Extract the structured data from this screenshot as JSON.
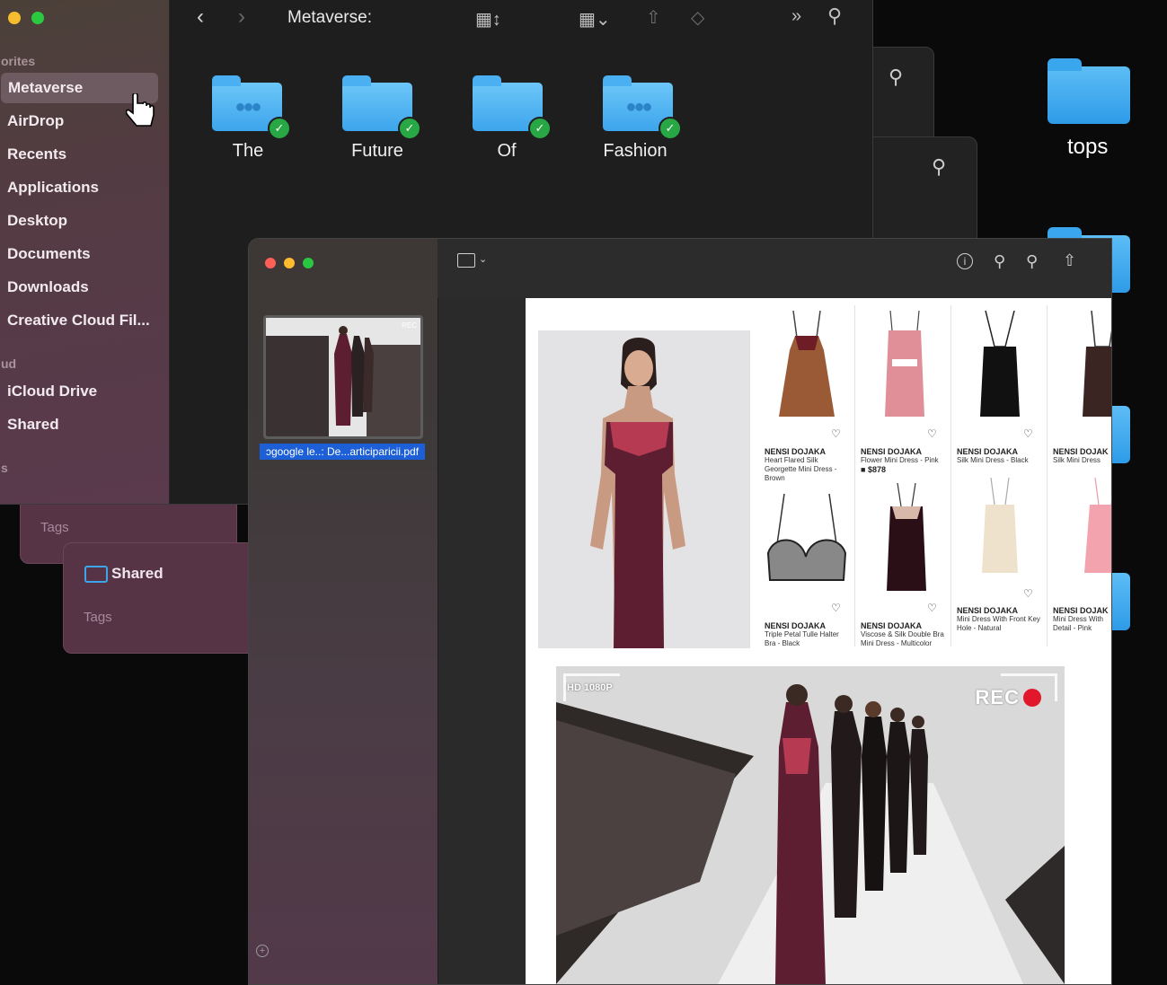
{
  "desktop": {
    "folder_label": "tops"
  },
  "back_windows": {
    "tags_label_1": "Tags",
    "shared_label": "Shared",
    "tags_label_2": "Tags"
  },
  "finder": {
    "title": "Metaverse:",
    "sidebar": {
      "favorites_header": "orites",
      "icloud_header": "ud",
      "locations_header": "s",
      "items": [
        {
          "label": "Metaverse"
        },
        {
          "label": "AirDrop"
        },
        {
          "label": "Recents"
        },
        {
          "label": "Applications"
        },
        {
          "label": "Desktop"
        },
        {
          "label": "Documents"
        },
        {
          "label": "Downloads"
        },
        {
          "label": "Creative Cloud Fil..."
        }
      ],
      "icloud_items": [
        {
          "label": "iCloud Drive"
        },
        {
          "label": "Shared"
        }
      ]
    },
    "folders": [
      {
        "label": "The",
        "shared": true
      },
      {
        "label": "Future",
        "shared": false
      },
      {
        "label": "Of",
        "shared": false
      },
      {
        "label": "Fashion",
        "shared": true
      }
    ]
  },
  "preview": {
    "thumbnail_label": "ɔgoogle le..: De...articiparicii.pdf",
    "thumbnail_rec": "REC",
    "products": [
      {
        "brand": "NENSI DOJAKA",
        "name": "Heart Flared Silk Georgette Mini Dress - Brown",
        "price": ""
      },
      {
        "brand": "NENSI DOJAKA",
        "name": "Flower Mini Dress - Pink",
        "price": "$878"
      },
      {
        "brand": "NENSI DOJAKA",
        "name": "Silk Mini Dress - Black",
        "price": ""
      },
      {
        "brand": "NENSI DOJAK",
        "name": "Silk Mini Dress",
        "price": ""
      },
      {
        "brand": "NENSI DOJAKA",
        "name": "Triple Petal Tulle Halter Bra - Black",
        "price": ""
      },
      {
        "brand": "NENSI DOJAKA",
        "name": "Viscose & Silk Double Bra Mini Dress - Multicolor",
        "price": ""
      },
      {
        "brand": "NENSI DOJAKA",
        "name": "Mini Dress With Front Key Hole - Natural",
        "price": ""
      },
      {
        "brand": "NENSI DOJAK",
        "name": "Mini Dress With Detail - Pink",
        "price": ""
      }
    ],
    "runway": {
      "rec_label": "REC",
      "hd_label": "HD 1080P"
    }
  },
  "colors": {
    "accent_blue": "#1c5fd6",
    "folder_blue": "#3da5ec",
    "shared_check": "#28a745",
    "rec_red": "#e3172c",
    "dress_burgundy": "#5c1e30"
  }
}
